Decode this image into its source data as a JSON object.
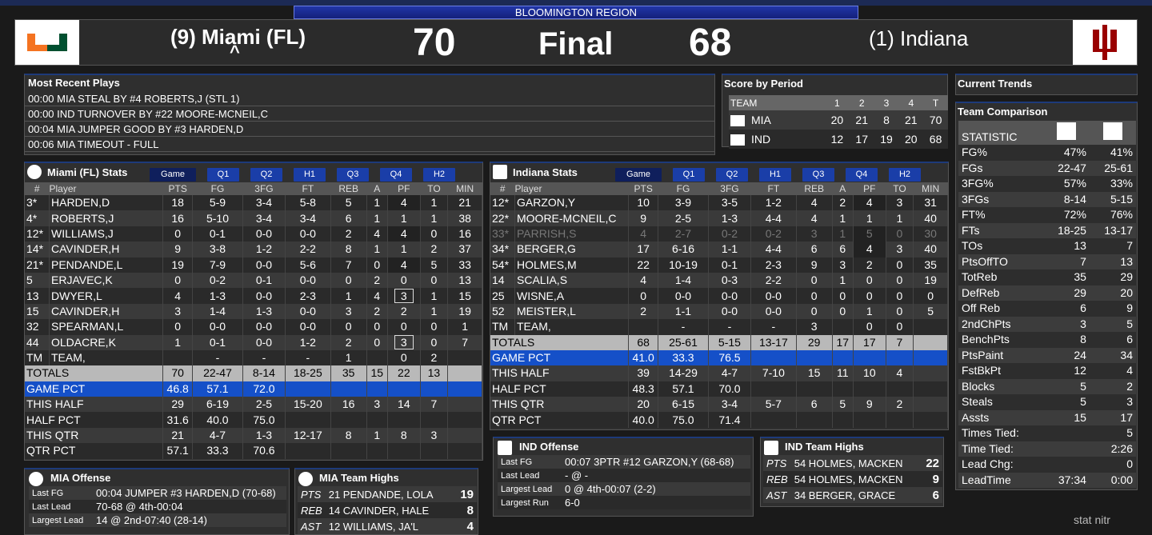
{
  "region": "BLOOMINGTON REGION",
  "score": {
    "away_name": "(9) Miami (FL)",
    "home_name": "(1) Indiana",
    "away_score": "70",
    "home_score": "68",
    "status": "Final",
    "possession": "^"
  },
  "plays": {
    "title": "Most Recent Plays",
    "items": [
      "00:00 MIA STEAL BY #4 ROBERTS,J (STL 1)",
      "00:00 IND TURNOVER BY #22 MOORE-MCNEIL,C",
      "00:04 MIA JUMPER GOOD BY #3 HARDEN,D",
      "00:06 MIA TIMEOUT - FULL"
    ]
  },
  "period": {
    "title": "Score by Period",
    "headers": [
      "TEAM",
      "1",
      "2",
      "3",
      "4",
      "T"
    ],
    "rows": [
      {
        "team": "MIA",
        "vals": [
          "20",
          "21",
          "8",
          "21",
          "70"
        ]
      },
      {
        "team": "IND",
        "vals": [
          "12",
          "17",
          "19",
          "20",
          "68"
        ]
      }
    ]
  },
  "trends": {
    "title": "Current Trends"
  },
  "comparison": {
    "title": "Team Comparison",
    "header": "STATISTIC",
    "rows": [
      [
        "FG%",
        "47%",
        "41%"
      ],
      [
        "FGs",
        "22-47",
        "25-61"
      ],
      [
        "3FG%",
        "57%",
        "33%"
      ],
      [
        "3FGs",
        "8-14",
        "5-15"
      ],
      [
        "FT%",
        "72%",
        "76%"
      ],
      [
        "FTs",
        "18-25",
        "13-17"
      ],
      [
        "TOs",
        "13",
        "7"
      ],
      [
        "PtsOffTO",
        "7",
        "13"
      ],
      [
        "TotReb",
        "35",
        "29"
      ],
      [
        "DefReb",
        "29",
        "20"
      ],
      [
        "Off Reb",
        "6",
        "9"
      ],
      [
        "2ndChPts",
        "3",
        "5"
      ],
      [
        "BenchPts",
        "8",
        "6"
      ],
      [
        "PtsPaint",
        "24",
        "34"
      ],
      [
        "FstBkPt",
        "12",
        "4"
      ],
      [
        "Blocks",
        "5",
        "2"
      ],
      [
        "Steals",
        "5",
        "3"
      ],
      [
        "Assts",
        "15",
        "17"
      ]
    ],
    "extra": [
      [
        "Times Tied:",
        "",
        "5"
      ],
      [
        "Time Tied:",
        "",
        "2:26"
      ],
      [
        "Lead Chg:",
        "",
        "0"
      ],
      [
        "LeadTime",
        "37:34",
        "0:00"
      ]
    ]
  },
  "tabs": [
    "Game",
    "Q1",
    "Q2",
    "H1",
    "Q3",
    "Q4",
    "H2"
  ],
  "colheads": [
    "#",
    "Player",
    "PTS",
    "FG",
    "3FG",
    "FT",
    "REB",
    "A",
    "PF",
    "TO",
    "MIN"
  ],
  "mia": {
    "title": "Miami (FL) Stats",
    "rows": [
      [
        "3*",
        "HARDEN,D",
        "18",
        "5-9",
        "3-4",
        "5-8",
        "5",
        "1",
        "4",
        "1",
        "21"
      ],
      [
        "4*",
        "ROBERTS,J",
        "16",
        "5-10",
        "3-4",
        "3-4",
        "6",
        "1",
        "1",
        "1",
        "38"
      ],
      [
        "12*",
        "WILLIAMS,J",
        "0",
        "0-1",
        "0-0",
        "0-0",
        "2",
        "4",
        "4",
        "0",
        "16"
      ],
      [
        "14*",
        "CAVINDER,H",
        "9",
        "3-8",
        "1-2",
        "2-2",
        "8",
        "1",
        "1",
        "2",
        "37"
      ],
      [
        "21*",
        "PENDANDE,L",
        "19",
        "7-9",
        "0-0",
        "5-6",
        "7",
        "0",
        "4",
        "5",
        "33"
      ],
      [
        "5",
        "ERJAVEC,K",
        "0",
        "0-2",
        "0-1",
        "0-0",
        "0",
        "2",
        "0",
        "0",
        "13"
      ],
      [
        "13",
        "DWYER,L",
        "4",
        "1-3",
        "0-0",
        "2-3",
        "1",
        "4",
        "3",
        "1",
        "15"
      ],
      [
        "15",
        "CAVINDER,H",
        "3",
        "1-4",
        "1-3",
        "0-0",
        "3",
        "2",
        "2",
        "1",
        "19"
      ],
      [
        "32",
        "SPEARMAN,L",
        "0",
        "0-0",
        "0-0",
        "0-0",
        "0",
        "0",
        "0",
        "0",
        "1"
      ],
      [
        "44",
        "OLDACRE,K",
        "1",
        "0-1",
        "0-0",
        "1-2",
        "2",
        "0",
        "3",
        "0",
        "7"
      ],
      [
        "TM",
        "TEAM,",
        "",
        "-",
        "-",
        "-",
        "1",
        "",
        "0",
        "2",
        ""
      ]
    ],
    "totals": [
      "TOTALS",
      "70",
      "22-47",
      "8-14",
      "18-25",
      "35",
      "15",
      "22",
      "13"
    ],
    "gamepct": [
      "GAME PCT",
      "46.8",
      "57.1",
      "72.0"
    ],
    "thishalf": [
      "THIS HALF",
      "29",
      "6-19",
      "2-5",
      "15-20",
      "16",
      "3",
      "14",
      "7"
    ],
    "halfpct": [
      "HALF PCT",
      "31.6",
      "40.0",
      "75.0"
    ],
    "thisqtr": [
      "THIS QTR",
      "21",
      "4-7",
      "1-3",
      "12-17",
      "8",
      "1",
      "8",
      "3"
    ],
    "qtrpct": [
      "QTR PCT",
      "57.1",
      "33.3",
      "70.6"
    ]
  },
  "ind": {
    "title": "Indiana Stats",
    "rows": [
      [
        "12*",
        "GARZON,Y",
        "10",
        "3-9",
        "3-5",
        "1-2",
        "4",
        "2",
        "4",
        "3",
        "31"
      ],
      [
        "22*",
        "MOORE-MCNEIL,C",
        "9",
        "2-5",
        "1-3",
        "4-4",
        "4",
        "1",
        "1",
        "1",
        "40"
      ],
      [
        "33*",
        "PARRISH,S",
        "4",
        "2-7",
        "0-2",
        "0-2",
        "3",
        "1",
        "5",
        "0",
        "30"
      ],
      [
        "34*",
        "BERGER,G",
        "17",
        "6-16",
        "1-1",
        "4-4",
        "6",
        "6",
        "4",
        "3",
        "40"
      ],
      [
        "54*",
        "HOLMES,M",
        "22",
        "10-19",
        "0-1",
        "2-3",
        "9",
        "3",
        "2",
        "0",
        "35"
      ],
      [
        "14",
        "SCALIA,S",
        "4",
        "1-4",
        "0-3",
        "2-2",
        "0",
        "1",
        "0",
        "0",
        "19"
      ],
      [
        "25",
        "WISNE,A",
        "0",
        "0-0",
        "0-0",
        "0-0",
        "0",
        "0",
        "0",
        "0",
        "0"
      ],
      [
        "52",
        "MEISTER,L",
        "2",
        "1-1",
        "0-0",
        "0-0",
        "0",
        "0",
        "1",
        "0",
        "5"
      ],
      [
        "TM",
        "TEAM,",
        "",
        "-",
        "-",
        "-",
        "3",
        "",
        "0",
        "0",
        ""
      ]
    ],
    "totals": [
      "TOTALS",
      "68",
      "25-61",
      "5-15",
      "13-17",
      "29",
      "17",
      "17",
      "7"
    ],
    "gamepct": [
      "GAME PCT",
      "41.0",
      "33.3",
      "76.5"
    ],
    "thishalf": [
      "THIS HALF",
      "39",
      "14-29",
      "4-7",
      "7-10",
      "15",
      "11",
      "10",
      "4"
    ],
    "halfpct": [
      "HALF PCT",
      "48.3",
      "57.1",
      "70.0"
    ],
    "thisqtr": [
      "THIS QTR",
      "20",
      "6-15",
      "3-4",
      "5-7",
      "6",
      "5",
      "9",
      "2"
    ],
    "qtrpct": [
      "QTR PCT",
      "40.0",
      "75.0",
      "71.4"
    ]
  },
  "mia_off": {
    "title": "MIA Offense",
    "rows": [
      [
        "Last FG",
        "00:04 JUMPER #3 HARDEN,D (70-68)"
      ],
      [
        "Last Lead",
        "70-68 @ 4th-00:04"
      ],
      [
        "Largest Lead",
        "14 @ 2nd-07:40 (28-14)"
      ]
    ]
  },
  "ind_off": {
    "title": "IND Offense",
    "rows": [
      [
        "Last FG",
        "00:07 3PTR #12 GARZON,Y (68-68)"
      ],
      [
        "Last Lead",
        "- @ -"
      ],
      [
        "Largest Lead",
        "0 @ 4th-00:07 (2-2)"
      ],
      [
        "Largest Run",
        "6-0"
      ]
    ]
  },
  "mia_hi": {
    "title": "MIA Team Highs",
    "rows": [
      [
        "PTS",
        "21 PENDANDE, LOLA",
        "19"
      ],
      [
        "REB",
        "14 CAVINDER, HALE",
        "8"
      ],
      [
        "AST",
        "12 WILLIAMS, JA'L",
        "4"
      ]
    ]
  },
  "ind_hi": {
    "title": "IND Team Highs",
    "rows": [
      [
        "PTS",
        "54 HOLMES, MACKEN",
        "22"
      ],
      [
        "REB",
        "54 HOLMES, MACKEN",
        "9"
      ],
      [
        "AST",
        "34 BERGER, GRACE",
        "6"
      ]
    ]
  },
  "brand": "stat nitr",
  "colors": {
    "miami_green": "#005030",
    "miami_orange": "#f47321",
    "indiana_red": "#990000",
    "accent_blue": "#1550c8"
  }
}
